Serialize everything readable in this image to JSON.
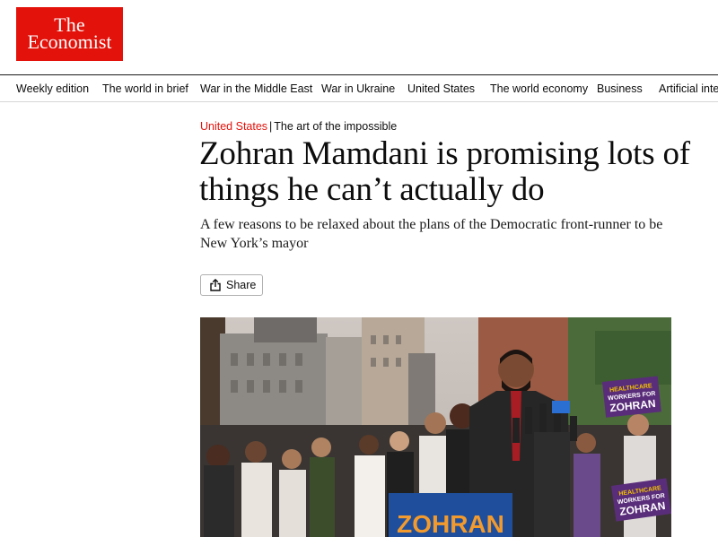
{
  "logo": {
    "line1": "The",
    "line2": "Economist"
  },
  "nav": {
    "items": [
      "Weekly edition",
      "The world in brief",
      "War in the Middle East",
      "War in Ukraine",
      "United States",
      "The world economy",
      "Business",
      "Artificial intel"
    ]
  },
  "article": {
    "section": "United States",
    "separator": "|",
    "rubric": "The art of the impossible",
    "headline": "Zohran Mamdani is promising lots of things he can’t actually do",
    "standfirst": "A few reasons to be relaxed about the plans of the Democratic front-runner to be New York’s mayor",
    "share_label": "Share"
  },
  "photo": {
    "podium_sign": "ZOHRAN",
    "placard_left": "HEALTHCARE\nWORKERS FOR\nZOHRAN",
    "placard_right": "HEALTHCARE\nWORKERS FOR\nZOHRAN"
  },
  "colors": {
    "brand_red": "#e3120b",
    "podium_blue": "#1f4f9c",
    "podium_orange": "#f29a2e"
  }
}
